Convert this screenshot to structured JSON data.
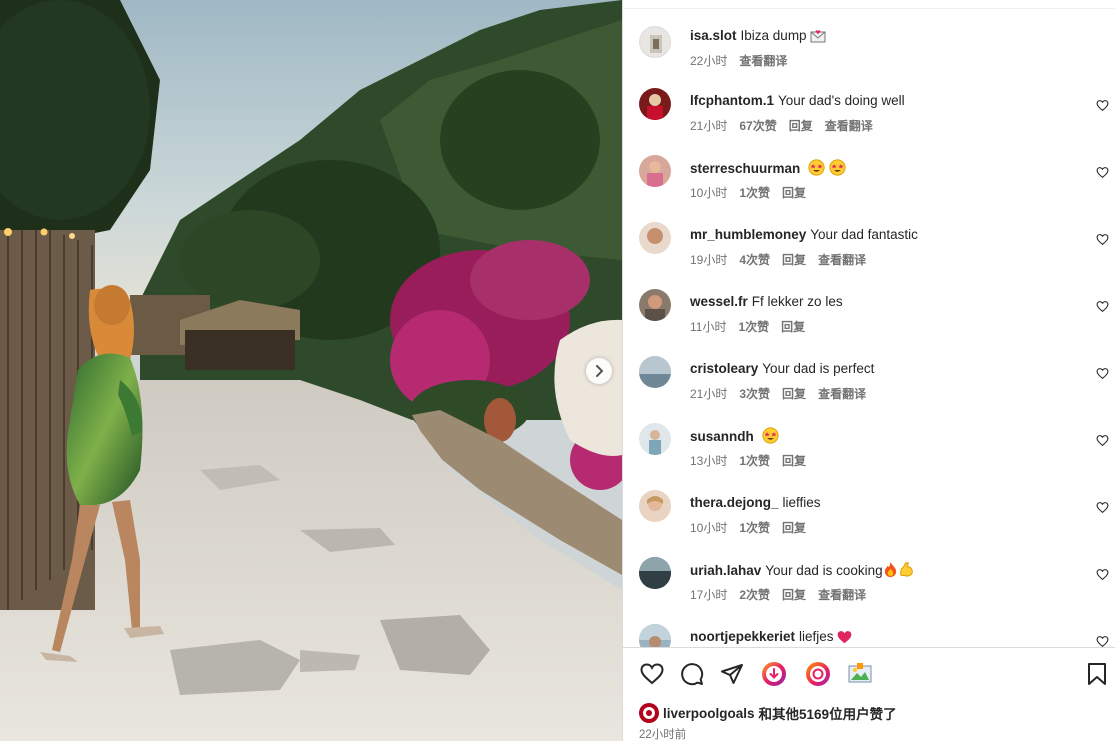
{
  "post": {
    "author": "isa.slot",
    "caption": "Ibiza dump",
    "caption_time": "22小时",
    "caption_translate": "查看翻译"
  },
  "comments": [
    {
      "user": "lfcphantom.1",
      "text": "Your dad's doing well",
      "time": "21小时",
      "likes": "67次赞",
      "reply": "回复",
      "translate": "查看翻译"
    },
    {
      "user": "sterreschuurman",
      "text": "",
      "emoji": [
        "star-eyes",
        "star-eyes"
      ],
      "time": "10小时",
      "likes": "1次赞",
      "reply": "回复",
      "translate": ""
    },
    {
      "user": "mr_humblemoney",
      "text": "Your dad fantastic",
      "time": "19小时",
      "likes": "4次赞",
      "reply": "回复",
      "translate": "查看翻译"
    },
    {
      "user": "wessel.fr",
      "text": "Ff lekker zo les",
      "time": "11小时",
      "likes": "1次赞",
      "reply": "回复",
      "translate": ""
    },
    {
      "user": "cristoleary",
      "text": "Your dad is perfect",
      "time": "21小时",
      "likes": "3次赞",
      "reply": "回复",
      "translate": "查看翻译"
    },
    {
      "user": "susanndh",
      "text": "",
      "emoji": [
        "star-eyes"
      ],
      "time": "13小时",
      "likes": "1次赞",
      "reply": "回复",
      "translate": ""
    },
    {
      "user": "thera.dejong_",
      "text": "lieffies",
      "time": "10小时",
      "likes": "1次赞",
      "reply": "回复",
      "translate": ""
    },
    {
      "user": "uriah.lahav",
      "text": "Your dad is cooking",
      "emoji": [
        "fire",
        "flexed-biceps"
      ],
      "time": "17小时",
      "likes": "2次赞",
      "reply": "回复",
      "translate": "查看翻译"
    },
    {
      "user": "noortjepekkeriet",
      "text": "liefjes",
      "emoji": [
        "red-heart"
      ],
      "time": "",
      "likes": "",
      "reply": "",
      "translate": ""
    }
  ],
  "actions": {
    "like_icon": "heart-icon",
    "comment_icon": "comment-icon",
    "share_icon": "paper-plane-icon",
    "save_icon": "bookmark-icon"
  },
  "likes_summary": {
    "user": "liverpoolgoals",
    "suffix": "和其他5169位用户赞了"
  },
  "post_time": "22小时前",
  "colors": {
    "heart_red": "#ed4956",
    "meta_gray": "#737373",
    "text": "#262626",
    "border": "#dbdbdb"
  }
}
